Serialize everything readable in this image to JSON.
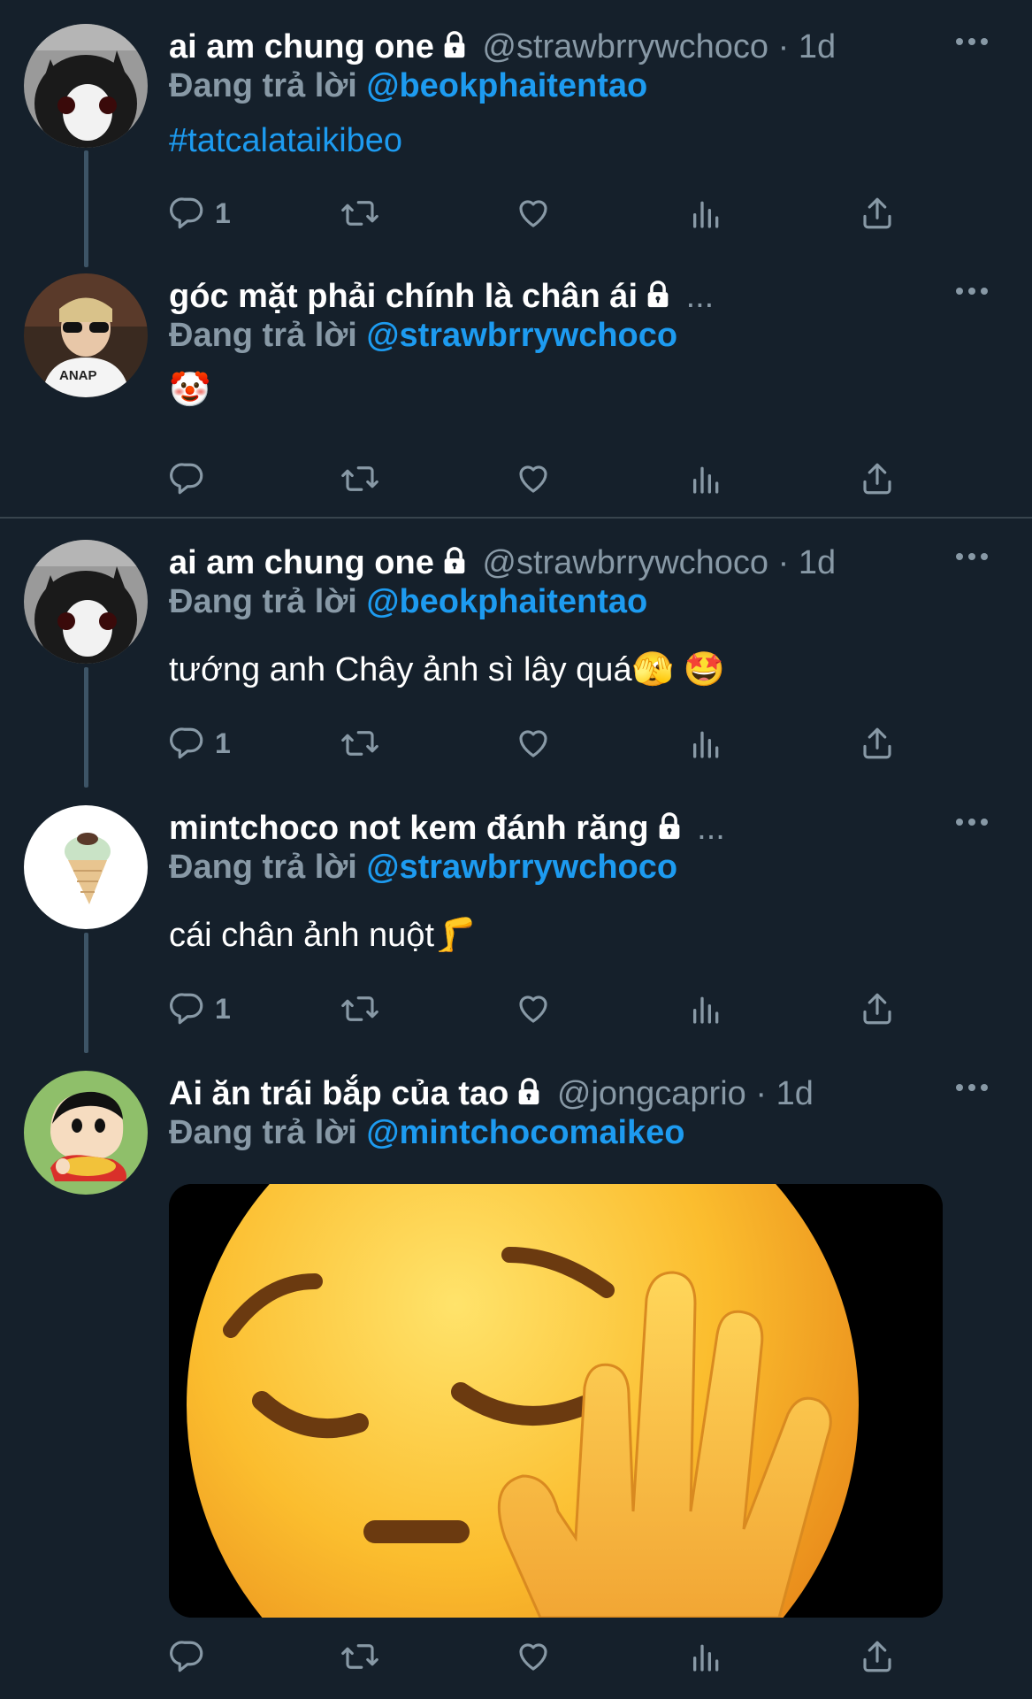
{
  "tweets": [
    {
      "name": "ai am chung one",
      "handle": "@strawbrrywchoco",
      "time": "1d",
      "reply_label": "Đang trả lời",
      "reply_to": "@beokphaitentao",
      "text": "#tatcalataikibeo",
      "reply_count": "1"
    },
    {
      "name": "góc mặt phải chính là chân ái",
      "truncation": "...",
      "reply_label": "Đang trả lời",
      "reply_to": "@strawbrrywchoco",
      "emoji": "🤡"
    },
    {
      "name": "ai am chung one",
      "handle": "@strawbrrywchoco",
      "time": "1d",
      "reply_label": "Đang trả lời",
      "reply_to": "@beokphaitentao",
      "text": " tướng anh Chây ảnh sì lây quá🫣 🤩",
      "reply_count": "1"
    },
    {
      "name": "mintchoco not kem đánh răng",
      "truncation": "...",
      "reply_label": "Đang trả lời",
      "reply_to": "@strawbrrywchoco",
      "text": "cái chân ảnh nuột🦵",
      "reply_count": "1"
    },
    {
      "name": "Ai ăn trái bắp của tao",
      "handle": "@jongcaprio",
      "time": "1d",
      "reply_label": "Đang trả lời",
      "reply_to": "@mintchocomaikeo"
    }
  ],
  "separator": "·",
  "icons": [
    "lock-icon",
    "more-icon",
    "reply-icon",
    "retweet-icon",
    "like-icon",
    "analytics-icon",
    "share-icon"
  ],
  "colors": {
    "background": "#15202b",
    "accent": "#1d9bf0",
    "muted": "#8899a6"
  }
}
